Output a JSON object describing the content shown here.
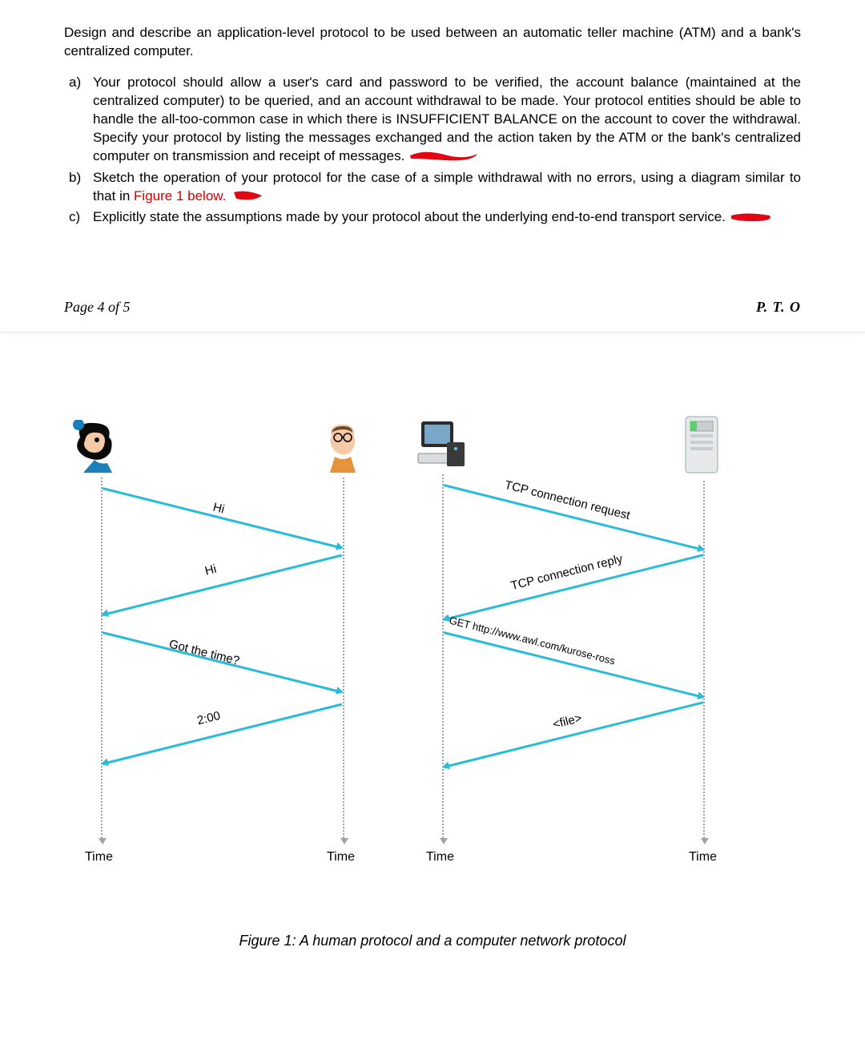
{
  "intro": "Design and describe an application-level protocol to be used between an automatic teller machine (ATM) and a bank's centralized computer.",
  "items": {
    "a_marker": "a)",
    "a_text": "Your protocol should allow a user's card and password to be verified, the account balance (maintained at the centralized computer) to be queried, and an account withdrawal to be made. Your protocol entities should be able to handle the all-too-common case in which there is INSUFFICIENT BALANCE on the account to cover the withdrawal. Specify your protocol by listing the messages exchanged and the action taken by the ATM or the bank's centralized computer on transmission and receipt of messages.",
    "b_marker": "b)",
    "b_text_before": "Sketch the operation of your protocol for the case of a simple withdrawal with no errors, using a diagram similar to that in ",
    "b_ref": "Figure 1 below.",
    "c_marker": "c)",
    "c_text": "Explicitly state the assumptions made by your protocol about the underlying end-to-end transport service."
  },
  "pagefoot_left": "Page 4 of 5",
  "pagefoot_right": "P. T. O",
  "figure": {
    "time_label": "Time",
    "msgs_left": {
      "m1": "Hi",
      "m2": "Hi",
      "m3": "Got the time?",
      "m4": "2:00"
    },
    "msgs_right": {
      "m1": "TCP connection request",
      "m2": "TCP connection reply",
      "m3": "GET http://www.awl.com/kurose-ross",
      "m4": "<file>"
    },
    "caption": "Figure 1: A human protocol and a computer network protocol"
  }
}
